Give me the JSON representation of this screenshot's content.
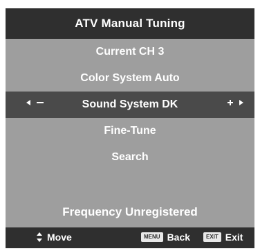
{
  "osd": {
    "title": "ATV  Manual Tuning",
    "items": [
      {
        "label": "Current CH 3",
        "selected": false
      },
      {
        "label": "Color System Auto",
        "selected": false
      },
      {
        "label": "Sound System DK",
        "selected": true,
        "left_controls": "◄ —",
        "right_controls": "+ ►"
      },
      {
        "label": "Fine-Tune",
        "selected": false
      },
      {
        "label": "Search",
        "selected": false
      }
    ],
    "status": "Frequency Unregistered",
    "hints": {
      "move_label": "Move",
      "back_key": "MENU",
      "back_label": "Back",
      "exit_key": "EXIT",
      "exit_label": "Exit"
    },
    "colors": {
      "panel": "#9e9e9e",
      "bars": "#2f2f2f",
      "selected_row": "#4a4a4a",
      "text": "#ffffff"
    },
    "icons": {
      "move": "up-down-arrows-icon",
      "left_arrow": "left-triangle-icon",
      "right_arrow": "right-triangle-icon"
    }
  }
}
